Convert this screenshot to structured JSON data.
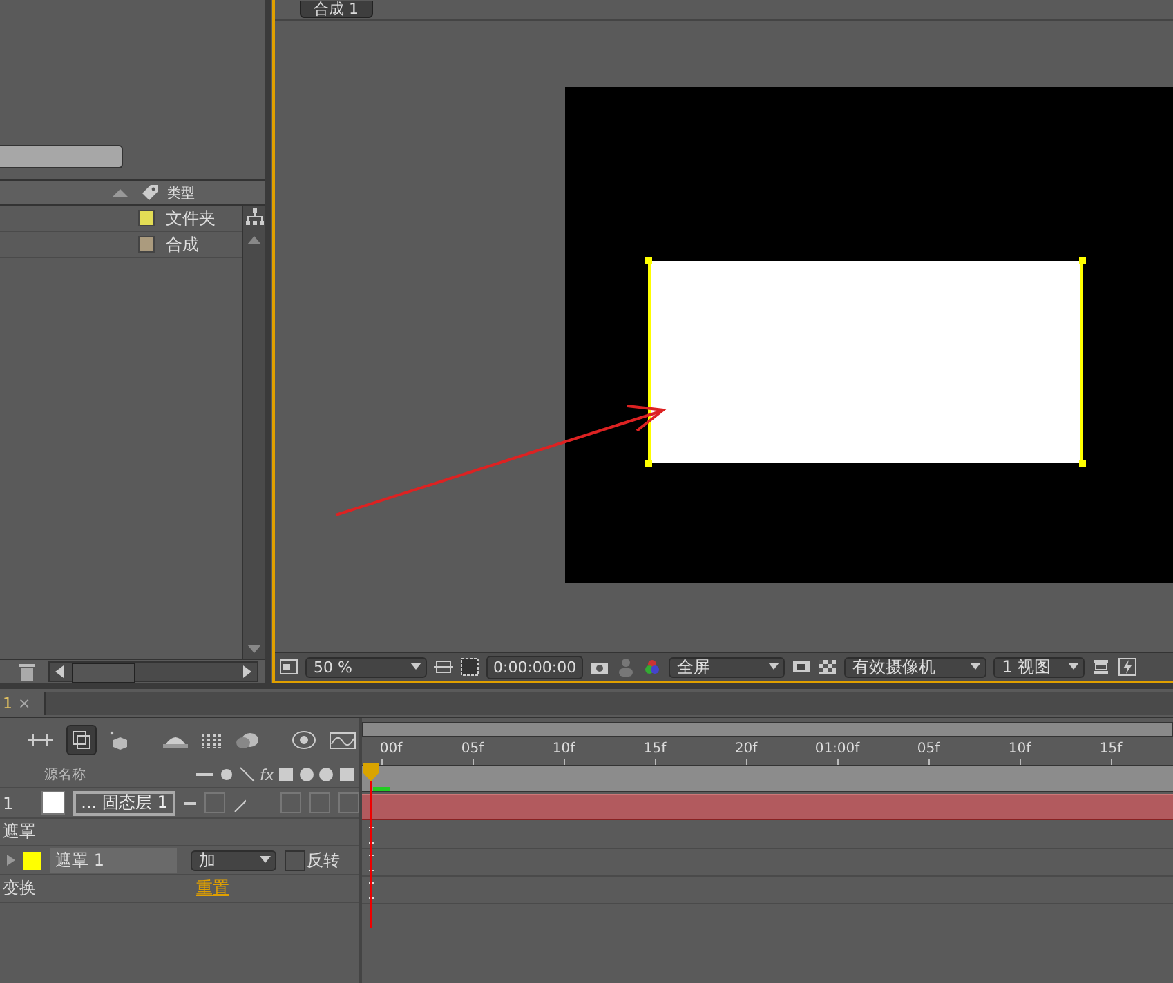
{
  "project": {
    "type_column": "类型",
    "items": [
      {
        "type": "文件夹",
        "color": "#e3dd55"
      },
      {
        "type": "合成",
        "color": "#ab9b7e"
      }
    ]
  },
  "viewer": {
    "tab": "合成 1",
    "zoom": "50 %",
    "timecode": "0:00:00:00",
    "resolution": "全屏",
    "camera": "有效摄像机",
    "views": "1 视图"
  },
  "timeline": {
    "tab": "1",
    "close": "×",
    "ruler": [
      "00f",
      "05f",
      "10f",
      "15f",
      "20f",
      "01:00f",
      "05f",
      "10f",
      "15f"
    ],
    "name_column": "源名称",
    "effects_switch": "fx",
    "layers": [
      {
        "number": "1",
        "name": "... 固态层 1",
        "color": "#ffffff"
      }
    ],
    "mask_group": "遮罩",
    "masks": [
      {
        "name": "遮罩 1",
        "color": "#ffff00",
        "mode": "加",
        "inverted": false,
        "invert_label": "反转"
      }
    ],
    "transform": {
      "label": "变换",
      "reset": "重置"
    }
  }
}
